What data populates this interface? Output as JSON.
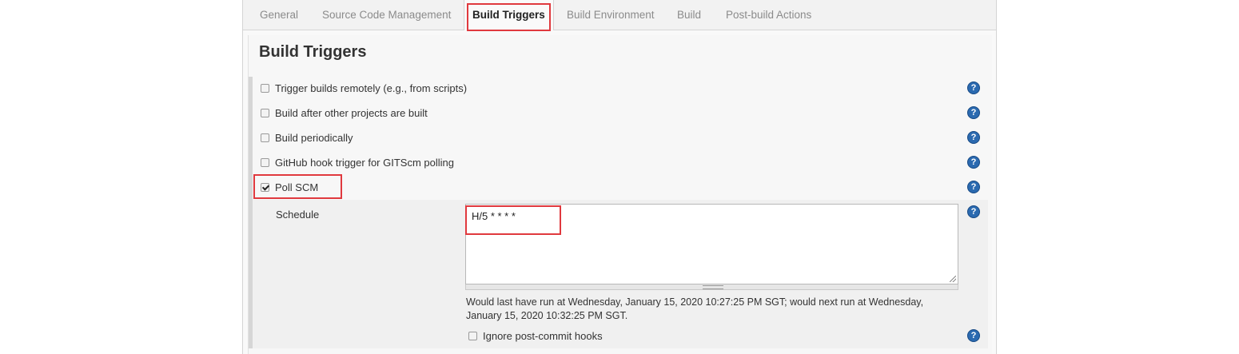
{
  "tabs": [
    {
      "label": "General",
      "active": false
    },
    {
      "label": "Source Code Management",
      "active": false
    },
    {
      "label": "Build Triggers",
      "active": true
    },
    {
      "label": "Build Environment",
      "active": false
    },
    {
      "label": "Build",
      "active": false
    },
    {
      "label": "Post-build Actions",
      "active": false
    }
  ],
  "section": {
    "title": "Build Triggers"
  },
  "triggers": [
    {
      "label": "Trigger builds remotely (e.g., from scripts)",
      "checked": false
    },
    {
      "label": "Build after other projects are built",
      "checked": false
    },
    {
      "label": "Build periodically",
      "checked": false
    },
    {
      "label": "GitHub hook trigger for GITScm polling",
      "checked": false
    },
    {
      "label": "Poll SCM",
      "checked": true
    }
  ],
  "poll_scm": {
    "schedule_label": "Schedule",
    "schedule_value": "H/5 * * * *",
    "note": "Would last have run at Wednesday, January 15, 2020 10:27:25 PM SGT; would next run at Wednesday, January 15, 2020 10:32:25 PM SGT.",
    "ignore_label": "Ignore post-commit hooks",
    "ignore_checked": false
  },
  "help_icon_glyph": "?",
  "colors": {
    "highlight": "#e0393e",
    "help": "#2b6ab0"
  }
}
